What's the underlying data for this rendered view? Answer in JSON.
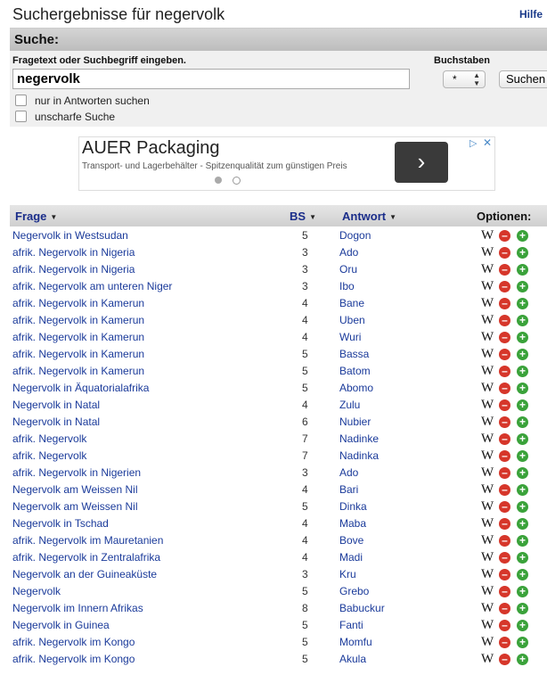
{
  "page": {
    "title": "Suchergebnisse für negervolk",
    "help": "Hilfe"
  },
  "search": {
    "heading": "Suche:",
    "prompt": "Fragetext oder Suchbegriff eingeben.",
    "value": "negervolk",
    "letters_label": "Buchstaben",
    "letters_value": "*",
    "button": "Suchen",
    "options": [
      {
        "label": "nur in Antworten suchen",
        "checked": false
      },
      {
        "label": "unscharfe Suche",
        "checked": false
      }
    ]
  },
  "ad": {
    "title": "AUER Packaging",
    "text": "Transport- und Lagerbehälter - Spitzenqualität zum günstigen Preis",
    "arrow": "›",
    "choices": "▷",
    "close": "✕"
  },
  "results": {
    "headers": {
      "frage": "Frage",
      "bs": "BS",
      "antwort": "Antwort",
      "options": "Optionen:"
    },
    "rows": [
      {
        "frage": "Negervolk in Westsudan",
        "bs": "5",
        "antwort": "Dogon"
      },
      {
        "frage": "afrik. Negervolk in Nigeria",
        "bs": "3",
        "antwort": "Ado"
      },
      {
        "frage": "afrik. Negervolk in Nigeria",
        "bs": "3",
        "antwort": "Oru"
      },
      {
        "frage": "afrik. Negervolk am unteren Niger",
        "bs": "3",
        "antwort": "Ibo"
      },
      {
        "frage": "afrik. Negervolk in Kamerun",
        "bs": "4",
        "antwort": "Bane"
      },
      {
        "frage": "afrik. Negervolk in Kamerun",
        "bs": "4",
        "antwort": "Uben"
      },
      {
        "frage": "afrik. Negervolk in Kamerun",
        "bs": "4",
        "antwort": "Wuri"
      },
      {
        "frage": "afrik. Negervolk in Kamerun",
        "bs": "5",
        "antwort": "Bassa"
      },
      {
        "frage": "afrik. Negervolk in Kamerun",
        "bs": "5",
        "antwort": "Batom"
      },
      {
        "frage": "Negervolk in Äquatorialafrika",
        "bs": "5",
        "antwort": "Abomo"
      },
      {
        "frage": "Negervolk in Natal",
        "bs": "4",
        "antwort": "Zulu"
      },
      {
        "frage": "Negervolk in Natal",
        "bs": "6",
        "antwort": "Nubier"
      },
      {
        "frage": "afrik. Negervolk",
        "bs": "7",
        "antwort": "Nadinke"
      },
      {
        "frage": "afrik. Negervolk",
        "bs": "7",
        "antwort": "Nadinka"
      },
      {
        "frage": "afrik. Negervolk in Nigerien",
        "bs": "3",
        "antwort": "Ado"
      },
      {
        "frage": "Negervolk am Weissen Nil",
        "bs": "4",
        "antwort": "Bari"
      },
      {
        "frage": "Negervolk am Weissen Nil",
        "bs": "5",
        "antwort": "Dinka"
      },
      {
        "frage": "Negervolk in Tschad",
        "bs": "4",
        "antwort": "Maba"
      },
      {
        "frage": "afrik. Negervolk im Mauretanien",
        "bs": "4",
        "antwort": "Bove"
      },
      {
        "frage": "afrik. Negervolk in Zentralafrika",
        "bs": "4",
        "antwort": "Madi"
      },
      {
        "frage": "Negervolk an der Guineaküste",
        "bs": "3",
        "antwort": "Kru"
      },
      {
        "frage": "Negervolk",
        "bs": "5",
        "antwort": "Grebo"
      },
      {
        "frage": "Negervolk im Innern Afrikas",
        "bs": "8",
        "antwort": "Babuckur"
      },
      {
        "frage": "Negervolk in Guinea",
        "bs": "5",
        "antwort": "Fanti"
      },
      {
        "frage": "afrik. Negervolk im Kongo",
        "bs": "5",
        "antwort": "Momfu"
      },
      {
        "frage": "afrik. Negervolk im Kongo",
        "bs": "5",
        "antwort": "Akula"
      }
    ],
    "option_icons": {
      "wiki": "W",
      "remove": "–",
      "add": "+"
    }
  },
  "colors": {
    "link": "#1a3a9a",
    "header_link": "#1a2d8a",
    "remove": "#d6362a",
    "add": "#3aa23a"
  }
}
